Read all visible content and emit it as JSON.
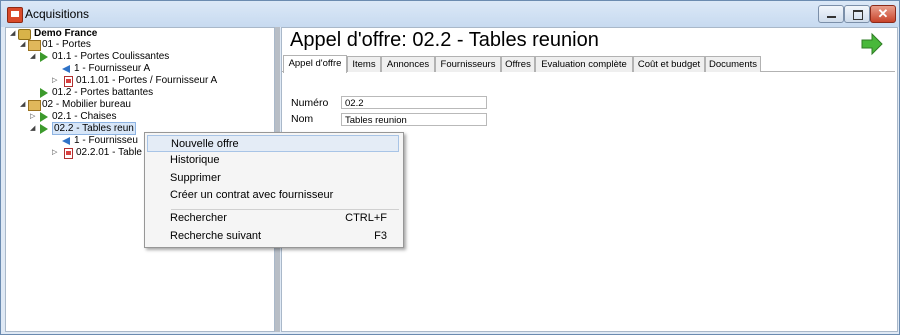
{
  "window": {
    "title": "Acquisitions",
    "icons": {
      "app": "app-icon",
      "minimize": "minimize-icon",
      "maximize": "maximize-icon",
      "close": "close-icon"
    },
    "close_glyph": "✕"
  },
  "tree": {
    "nodes": [
      {
        "label": "Demo France",
        "icon": "database-icon",
        "expander": "◢"
      },
      {
        "label": "01 - Portes",
        "icon": "folder-icon",
        "expander": "◢"
      },
      {
        "label": "01.1 - Portes Coulissantes",
        "icon": "green-arrow-icon",
        "expander": "◢"
      },
      {
        "label": "1 - Fournisseur A",
        "icon": "blue-arrow-icon"
      },
      {
        "label": "01.1.01 - Portes / Fournisseur A",
        "icon": "document-icon",
        "expander": "▷"
      },
      {
        "label": "01.2 - Portes battantes",
        "icon": "green-arrow-icon"
      },
      {
        "label": "02 - Mobilier bureau",
        "icon": "folder-icon",
        "expander": "◢"
      },
      {
        "label": "02.1 - Chaises",
        "icon": "green-arrow-icon",
        "expander": "▷"
      },
      {
        "label": "02.2 - Tables reun",
        "icon": "green-arrow-icon",
        "expander": "◢"
      },
      {
        "label": "1 - Fournisseu",
        "icon": "blue-arrow-icon"
      },
      {
        "label": "02.2.01 - Table",
        "icon": "document-icon",
        "expander": "▷"
      }
    ]
  },
  "header": {
    "title": "Appel d'offre: 02.2 - Tables reunion",
    "next_icon": "next-arrow-icon"
  },
  "tabs": [
    {
      "label": "Appel d'offre"
    },
    {
      "label": "Items"
    },
    {
      "label": "Annonces"
    },
    {
      "label": "Fournisseurs"
    },
    {
      "label": "Offres"
    },
    {
      "label": "Evaluation complète"
    },
    {
      "label": "Coût et budget"
    },
    {
      "label": "Documents"
    }
  ],
  "form": {
    "numero_label": "Numéro",
    "numero_value": "02.2",
    "nom_label": "Nom",
    "nom_value": "Tables reunion"
  },
  "context_menu": {
    "items": [
      {
        "label": "Nouvelle offre",
        "shortcut": ""
      },
      {
        "label": "Historique",
        "shortcut": ""
      },
      {
        "label": "Supprimer",
        "shortcut": ""
      },
      {
        "label": "Créer un contrat avec fournisseur",
        "shortcut": ""
      },
      {
        "label": "Rechercher",
        "shortcut": "CTRL+F"
      },
      {
        "label": "Recherche suivant",
        "shortcut": "F3"
      }
    ]
  },
  "colors": {
    "accent": "#3c9a2c",
    "selection": "#d7e6f8",
    "window_frame": "#dfe9f5",
    "close_button": "#c8432a"
  }
}
